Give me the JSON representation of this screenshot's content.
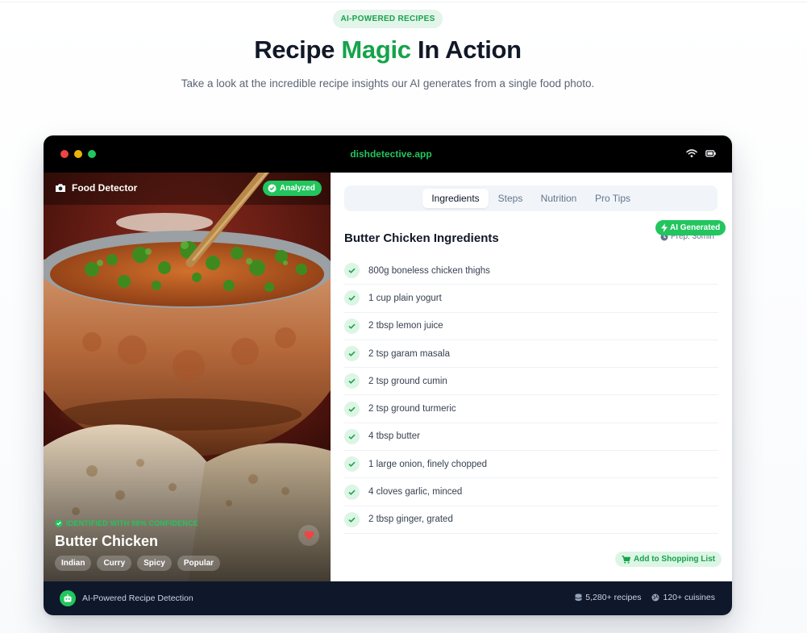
{
  "section": {
    "badge": "AI-POWERED RECIPES",
    "title_pre": "Recipe ",
    "title_accent": "Magic",
    "title_post": " In Action",
    "subtitle": "Take a look at the incredible recipe insights our AI generates from a single food photo."
  },
  "window": {
    "url": "dishdetective.app"
  },
  "photo_panel": {
    "label": "Food Detector",
    "status_badge": "Analyzed",
    "confidence_text": "IDENTIFIED WITH 98% CONFIDENCE",
    "dish_name": "Butter Chicken",
    "tags": [
      "Indian",
      "Curry",
      "Spicy",
      "Popular"
    ]
  },
  "tabs": [
    {
      "label": "Ingredients",
      "active": true
    },
    {
      "label": "Steps",
      "active": false
    },
    {
      "label": "Nutrition",
      "active": false
    },
    {
      "label": "Pro Tips",
      "active": false
    }
  ],
  "ingredients": {
    "title": "Butter Chicken Ingredients",
    "prep": "Prep: 30min",
    "ai_badge": "AI Generated",
    "items": [
      "800g boneless chicken thighs",
      "1 cup plain yogurt",
      "2 tbsp lemon juice",
      "2 tsp garam masala",
      "2 tsp ground cumin",
      "2 tsp ground turmeric",
      "4 tbsp butter",
      "1 large onion, finely chopped",
      "4 cloves garlic, minced",
      "2 tbsp ginger, grated"
    ],
    "shopping_button": "Add to Shopping List"
  },
  "footer": {
    "left_text": "AI-Powered Recipe Detection",
    "recipes_stat": "5,280+ recipes",
    "cuisines_stat": "120+ cuisines"
  },
  "colors": {
    "accent": "#16a34a",
    "accent_bright": "#22c55e",
    "footer_bg": "#0f172a",
    "titlebar_bg": "#000000"
  },
  "icons": [
    "camera-icon",
    "check-circle-icon",
    "wifi-icon",
    "battery-icon",
    "clock-icon",
    "bolt-icon",
    "check-icon",
    "heart-icon",
    "cart-icon",
    "robot-icon",
    "database-icon",
    "globe-icon"
  ]
}
